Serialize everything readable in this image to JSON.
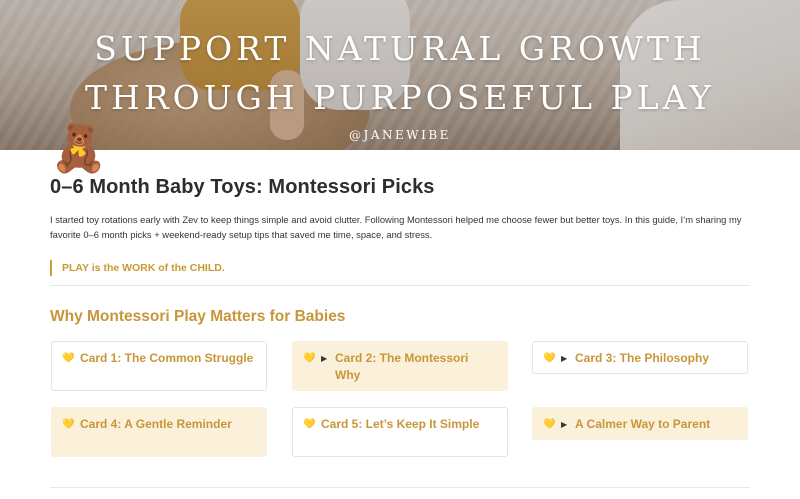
{
  "hero": {
    "line1": "SUPPORT NATURAL GROWTH",
    "line2": "THROUGH PURPOSEFUL PLAY",
    "handle": "@JANEWIBE"
  },
  "page": {
    "icon": "🧸",
    "title": "0–6 Month Baby Toys: Montessori Picks",
    "intro_line1": "I started toy rotations early with Zev to keep things simple and avoid clutter. Following Montessori helped me choose fewer but better toys. In this guide, I’m sharing my",
    "intro_line2": "favorite 0–6 month picks + weekend-ready setup tips that saved me time, space, and stress.",
    "quote": "PLAY is the WORK of the CHILD."
  },
  "section": {
    "heading": "Why Montessori Play Matters for Babies"
  },
  "cards": [
    {
      "label": "Card 1: The Common Struggle",
      "icon": "yellow-heart-icon"
    },
    {
      "label": "Card 2: The Montessori Why",
      "icon": "yellow-heart-icon"
    },
    {
      "label": "Card 3: The Philosophy",
      "icon": "yellow-heart-icon"
    },
    {
      "label": "Card 4: A Gentle Reminder",
      "icon": "yellow-heart-icon"
    },
    {
      "label": "Card 5: Let’s Keep It Simple",
      "icon": "yellow-heart-icon"
    },
    {
      "label": "A Calmer Way to Parent",
      "icon": "yellow-heart-icon"
    }
  ],
  "glyphs": {
    "heart": "💛",
    "toggle": "▶"
  },
  "colors": {
    "accent": "#c8963a",
    "card_tint": "#fbf1db",
    "quote_bar": "#c9a03c"
  }
}
